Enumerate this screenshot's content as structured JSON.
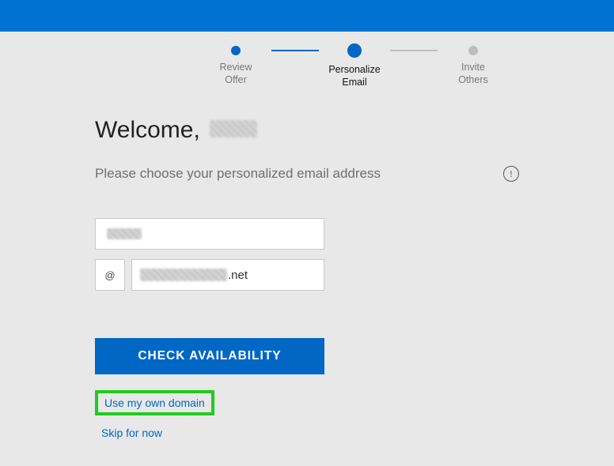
{
  "steps": {
    "s1": {
      "line1": "Review",
      "line2": "Offer"
    },
    "s2": {
      "line1": "Personalize",
      "line2": "Email"
    },
    "s3": {
      "line1": "Invite",
      "line2": "Others"
    }
  },
  "welcome_prefix": "Welcome,",
  "subtitle": "Please choose your personalized email address",
  "at_symbol": "@",
  "domain_suffix": ".net",
  "check_button": "CHECK AVAILABILITY",
  "own_domain_link": "Use my own domain",
  "skip_link": "Skip for now",
  "colors": {
    "brand": "#0067c5",
    "highlight": "#1ecc1e"
  }
}
